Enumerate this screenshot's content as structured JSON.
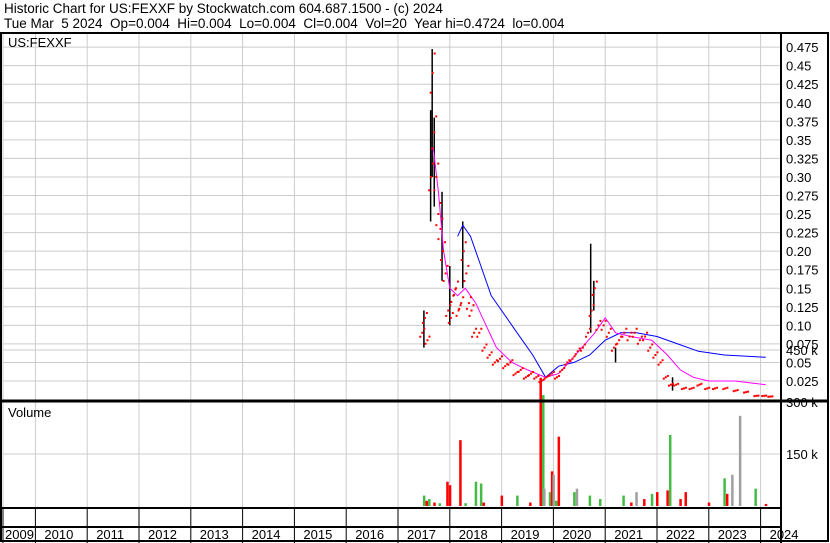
{
  "header": {
    "line1": "Historic Chart for US:FEXXF by Stockwatch.com 604.687.1500 - (c) 2024",
    "line2": "Tue Mar  5 2024  Op=0.004  Hi=0.004  Lo=0.004  Cl=0.004  Vol=20  Year hi=0.4724  lo=0.004"
  },
  "chart_data": {
    "type": "line",
    "symbol_label": "US:FEXXF",
    "volume_label": "Volume",
    "price_ticks": [
      0.025,
      0.05,
      0.075,
      0.1,
      0.125,
      0.15,
      0.175,
      0.2,
      0.225,
      0.25,
      0.275,
      0.3,
      0.325,
      0.35,
      0.375,
      0.4,
      0.425,
      0.45,
      0.475
    ],
    "price_tick_labels": [
      "0.025",
      "0.05",
      "0.075",
      "0.10",
      "0.125",
      "0.15",
      "0.175",
      "0.20",
      "0.225",
      "0.25",
      "0.275",
      "0.30",
      "0.325",
      "0.35",
      "0.375",
      "0.40",
      "0.425",
      "0.45",
      "0.475"
    ],
    "ylim": [
      0,
      0.49
    ],
    "volume_ticks": [
      150000,
      300000,
      450000
    ],
    "volume_tick_labels": [
      "150 k",
      "300 k",
      "450 k"
    ],
    "years": [
      "2009",
      "2010",
      "2011",
      "2012",
      "2013",
      "2014",
      "2015",
      "2016",
      "2017",
      "2018",
      "2019",
      "2020",
      "2021",
      "2022",
      "2023",
      "2024"
    ],
    "colors": {
      "price": "#ff0000",
      "bar": "#000000",
      "ma_short": "#ff00ff",
      "ma_long": "#0000ff",
      "vol_up": "#44bb44",
      "vol_down": "#ff0000",
      "vol_flat": "#a0a0a0"
    },
    "price_close": [
      [
        2017.45,
        0.09
      ],
      [
        2017.5,
        0.11
      ],
      [
        2017.55,
        0.08
      ],
      [
        2017.62,
        0.3
      ],
      [
        2017.65,
        0.44
      ],
      [
        2017.68,
        0.36
      ],
      [
        2017.72,
        0.3
      ],
      [
        2017.76,
        0.25
      ],
      [
        2017.8,
        0.23
      ],
      [
        2017.85,
        0.2
      ],
      [
        2017.9,
        0.17
      ],
      [
        2017.95,
        0.12
      ],
      [
        2018.0,
        0.11
      ],
      [
        2018.05,
        0.14
      ],
      [
        2018.1,
        0.15
      ],
      [
        2018.15,
        0.12
      ],
      [
        2018.2,
        0.13
      ],
      [
        2018.25,
        0.2
      ],
      [
        2018.3,
        0.17
      ],
      [
        2018.35,
        0.13
      ],
      [
        2018.4,
        0.12
      ],
      [
        2018.45,
        0.09
      ],
      [
        2018.55,
        0.09
      ],
      [
        2018.65,
        0.07
      ],
      [
        2018.75,
        0.06
      ],
      [
        2018.85,
        0.05
      ],
      [
        2018.95,
        0.055
      ],
      [
        2019.05,
        0.045
      ],
      [
        2019.15,
        0.05
      ],
      [
        2019.25,
        0.035
      ],
      [
        2019.35,
        0.04
      ],
      [
        2019.45,
        0.03
      ],
      [
        2019.55,
        0.035
      ],
      [
        2019.65,
        0.03
      ],
      [
        2019.75,
        0.025
      ],
      [
        2019.85,
        0.03
      ],
      [
        2019.95,
        0.035
      ],
      [
        2020.05,
        0.03
      ],
      [
        2020.15,
        0.04
      ],
      [
        2020.25,
        0.05
      ],
      [
        2020.35,
        0.055
      ],
      [
        2020.45,
        0.065
      ],
      [
        2020.55,
        0.07
      ],
      [
        2020.65,
        0.09
      ],
      [
        2020.72,
        0.12
      ],
      [
        2020.78,
        0.15
      ],
      [
        2020.85,
        0.1
      ],
      [
        2020.95,
        0.1
      ],
      [
        2021.05,
        0.09
      ],
      [
        2021.15,
        0.07
      ],
      [
        2021.25,
        0.08
      ],
      [
        2021.35,
        0.09
      ],
      [
        2021.45,
        0.085
      ],
      [
        2021.55,
        0.09
      ],
      [
        2021.65,
        0.08
      ],
      [
        2021.75,
        0.085
      ],
      [
        2021.85,
        0.07
      ],
      [
        2021.95,
        0.06
      ],
      [
        2022.05,
        0.05
      ],
      [
        2022.15,
        0.03
      ],
      [
        2022.25,
        0.02
      ],
      [
        2022.35,
        0.02
      ],
      [
        2022.5,
        0.015
      ],
      [
        2022.65,
        0.015
      ],
      [
        2022.8,
        0.02
      ],
      [
        2022.95,
        0.015
      ],
      [
        2023.1,
        0.015
      ],
      [
        2023.3,
        0.015
      ],
      [
        2023.5,
        0.012
      ],
      [
        2023.7,
        0.01
      ],
      [
        2023.9,
        0.005
      ],
      [
        2024.05,
        0.005
      ],
      [
        2024.17,
        0.004
      ]
    ],
    "price_range_bars": [
      [
        2017.5,
        0.07,
        0.12
      ],
      [
        2017.63,
        0.24,
        0.39
      ],
      [
        2017.66,
        0.3,
        0.4724
      ],
      [
        2017.7,
        0.26,
        0.38
      ],
      [
        2017.85,
        0.16,
        0.28
      ],
      [
        2018.25,
        0.15,
        0.24
      ],
      [
        2018.0,
        0.1,
        0.18
      ],
      [
        2020.72,
        0.09,
        0.21
      ],
      [
        2020.78,
        0.12,
        0.16
      ],
      [
        2021.2,
        0.05,
        0.07
      ],
      [
        2022.3,
        0.012,
        0.03
      ]
    ],
    "ma_short": [
      [
        2017.68,
        0.34
      ],
      [
        2017.78,
        0.28
      ],
      [
        2017.88,
        0.2
      ],
      [
        2018.0,
        0.15
      ],
      [
        2018.15,
        0.14
      ],
      [
        2018.3,
        0.15
      ],
      [
        2018.5,
        0.13
      ],
      [
        2018.7,
        0.1
      ],
      [
        2018.9,
        0.07
      ],
      [
        2019.2,
        0.05
      ],
      [
        2019.5,
        0.04
      ],
      [
        2019.85,
        0.03
      ],
      [
        2020.1,
        0.035
      ],
      [
        2020.3,
        0.05
      ],
      [
        2020.55,
        0.07
      ],
      [
        2020.8,
        0.09
      ],
      [
        2021.0,
        0.11
      ],
      [
        2021.2,
        0.09
      ],
      [
        2021.5,
        0.085
      ],
      [
        2021.9,
        0.08
      ],
      [
        2022.2,
        0.06
      ],
      [
        2022.45,
        0.04
      ],
      [
        2022.7,
        0.03
      ],
      [
        2023.0,
        0.025
      ],
      [
        2023.5,
        0.025
      ],
      [
        2024.1,
        0.02
      ]
    ],
    "ma_long": [
      [
        2018.15,
        0.22
      ],
      [
        2018.25,
        0.235
      ],
      [
        2018.4,
        0.22
      ],
      [
        2018.6,
        0.18
      ],
      [
        2018.8,
        0.14
      ],
      [
        2019.0,
        0.12
      ],
      [
        2019.3,
        0.09
      ],
      [
        2019.6,
        0.06
      ],
      [
        2019.85,
        0.03
      ],
      [
        2020.1,
        0.045
      ],
      [
        2020.4,
        0.05
      ],
      [
        2020.7,
        0.06
      ],
      [
        2021.0,
        0.08
      ],
      [
        2021.3,
        0.09
      ],
      [
        2021.6,
        0.09
      ],
      [
        2022.0,
        0.085
      ],
      [
        2022.4,
        0.075
      ],
      [
        2022.8,
        0.065
      ],
      [
        2023.3,
        0.06
      ],
      [
        2024.1,
        0.057
      ]
    ],
    "volume": [
      [
        2017.5,
        30000,
        "up"
      ],
      [
        2017.55,
        15000,
        "down"
      ],
      [
        2017.6,
        20000,
        "up"
      ],
      [
        2017.7,
        10000,
        "down"
      ],
      [
        2017.8,
        8000,
        "up"
      ],
      [
        2017.95,
        70000,
        "down"
      ],
      [
        2018.0,
        60000,
        "down"
      ],
      [
        2018.2,
        190000,
        "down"
      ],
      [
        2018.3,
        8000,
        "up"
      ],
      [
        2018.5,
        70000,
        "up"
      ],
      [
        2018.6,
        65000,
        "up"
      ],
      [
        2018.65,
        10000,
        "down"
      ],
      [
        2019.0,
        30000,
        "down"
      ],
      [
        2019.3,
        30000,
        "up"
      ],
      [
        2019.55,
        10000,
        "down"
      ],
      [
        2019.75,
        370000,
        "down"
      ],
      [
        2019.8,
        320000,
        "up"
      ],
      [
        2019.82,
        50000,
        "flat"
      ],
      [
        2019.93,
        40000,
        "up"
      ],
      [
        2019.97,
        100000,
        "down"
      ],
      [
        2020.0,
        90000,
        "flat"
      ],
      [
        2020.05,
        15000,
        "up"
      ],
      [
        2020.1,
        200000,
        "down"
      ],
      [
        2020.4,
        40000,
        "up"
      ],
      [
        2020.45,
        50000,
        "flat"
      ],
      [
        2020.7,
        30000,
        "up"
      ],
      [
        2020.9,
        20000,
        "up"
      ],
      [
        2021.35,
        30000,
        "up"
      ],
      [
        2021.5,
        10000,
        "down"
      ],
      [
        2021.6,
        40000,
        "flat"
      ],
      [
        2021.75,
        20000,
        "down"
      ],
      [
        2021.9,
        35000,
        "up"
      ],
      [
        2022.0,
        40000,
        "down"
      ],
      [
        2022.2,
        45000,
        "down"
      ],
      [
        2022.25,
        205000,
        "up"
      ],
      [
        2022.45,
        20000,
        "down"
      ],
      [
        2022.55,
        40000,
        "down"
      ],
      [
        2023.0,
        10000,
        "down"
      ],
      [
        2023.3,
        80000,
        "up"
      ],
      [
        2023.35,
        35000,
        "down"
      ],
      [
        2023.45,
        90000,
        "flat"
      ],
      [
        2023.6,
        260000,
        "flat"
      ],
      [
        2023.9,
        50000,
        "up"
      ],
      [
        2024.1,
        6000,
        "down"
      ]
    ]
  }
}
